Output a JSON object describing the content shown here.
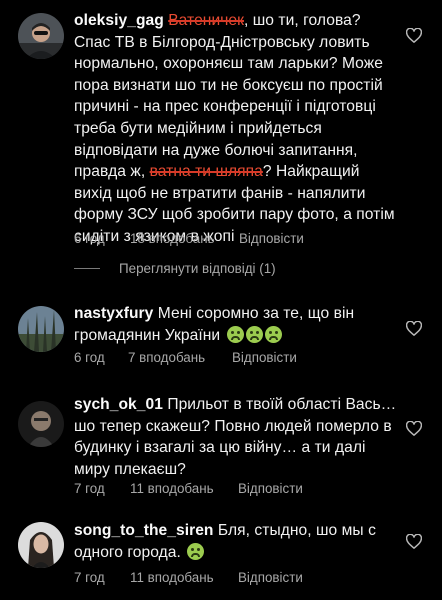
{
  "comments": [
    {
      "username": "oleksiy_gag",
      "struck_1": "Ватеничек",
      "text_1": ", шо ти, голова? Спас ТВ в Білгород-Дністровську ловить нормально, охороняєш там ларьки? Може пора визнати шо ти не боксуєш по простій причині - на прес конференції і підготовці треба бути медійним і прийдеться відповідати на дуже болючі запитання, правда ж, ",
      "struck_2": "ватна ти шляпа",
      "text_2": "? Найкращий вихід щоб не втратити фанів - напялити форму ЗСУ щоб зробити пару фото, а потім сидіти з язиком в жопі",
      "time": "6 год",
      "likes": "18 вподобань",
      "reply": "Відповісти"
    },
    {
      "username": "nastyxfury",
      "text": "Мені соромно за те, що він громадянин України",
      "emoji_names": [
        "nauseated-face-icon",
        "nauseated-face-icon",
        "nauseated-face-icon"
      ],
      "time": "6 год",
      "likes": "7 вподобань",
      "reply": "Відповісти"
    },
    {
      "username": "sych_ok_01",
      "text": "Прильот в твоїй області Вась… шо тепер скажеш? Повно людей померло в будинку і взагалі за цю війну… а ти далі миру плекаєш?",
      "time": "7 год",
      "likes": "11 вподобань",
      "reply": "Відповісти"
    },
    {
      "username": "song_to_the_siren",
      "text": "Бля, стыдно, шо мы с одного города.",
      "emoji_name": "nauseated-face-icon",
      "time": "7 год",
      "likes": "11 вподобань",
      "reply": "Відповісти"
    }
  ],
  "view_replies": "Переглянути відповіді (1)",
  "colors": {
    "background": "#000000",
    "text": "#f2f2f2",
    "meta": "#a8a8a8",
    "strike": "#e84b32"
  }
}
